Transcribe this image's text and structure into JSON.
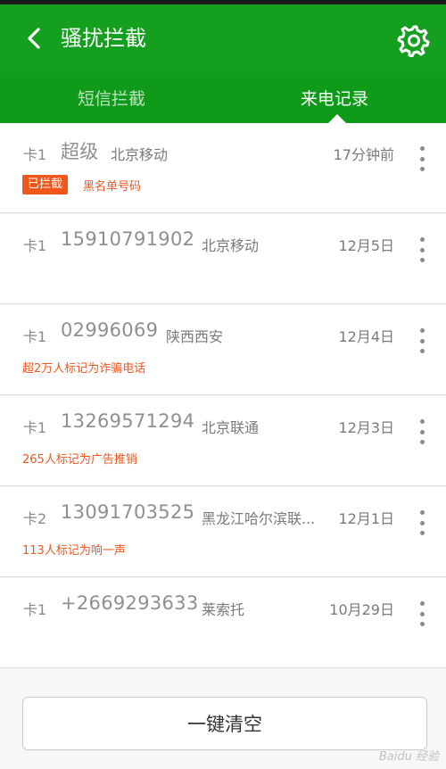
{
  "header": {
    "title": "骚扰拦截"
  },
  "tabs": [
    {
      "label": "短信拦截"
    },
    {
      "label": "来电记录"
    }
  ],
  "calls": [
    {
      "card": "卡1",
      "number": "超级",
      "location": "北京移动",
      "time": "17分钟前",
      "badge": "已拦截",
      "tag": "黑名单号码"
    },
    {
      "card": "卡1",
      "number": "15910791902",
      "location": "北京移动",
      "time": "12月5日",
      "badge": "",
      "tag": ""
    },
    {
      "card": "卡1",
      "number": "02996069",
      "location": "陕西西安",
      "time": "12月4日",
      "badge": "",
      "tag": "超2万人标记为诈骗电话"
    },
    {
      "card": "卡1",
      "number": "13269571294",
      "location": "北京联通",
      "time": "12月3日",
      "badge": "",
      "tag": "265人标记为广告推销"
    },
    {
      "card": "卡2",
      "number": "13091703525",
      "location": "黑龙江哈尔滨联...",
      "time": "12月1日",
      "badge": "",
      "tag": "113人标记为响一声"
    },
    {
      "card": "卡1",
      "number": "+2669293633",
      "location": "莱索托",
      "time": "10月29日",
      "badge": "",
      "tag": ""
    }
  ],
  "footer": {
    "clear_label": "一键清空"
  },
  "watermark": "Baidu 经验",
  "colors": {
    "brand": "#14a01e",
    "tab_bar": "#0f9a1a",
    "alert": "#f1561d"
  }
}
